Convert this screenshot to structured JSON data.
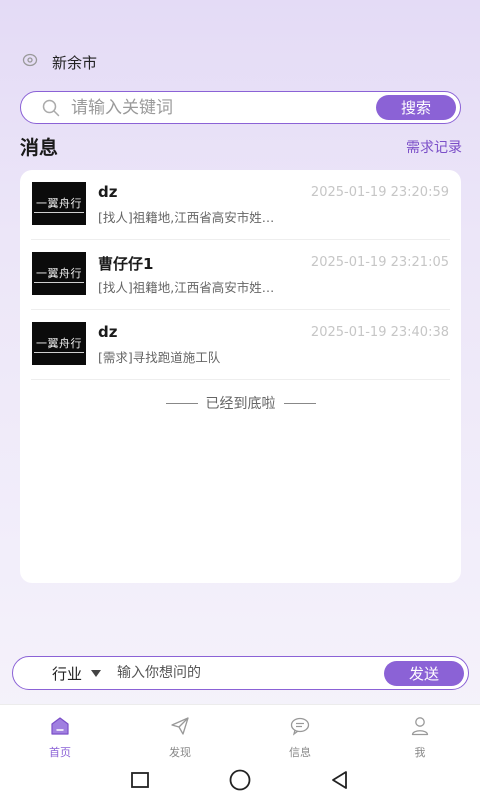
{
  "location": {
    "city": "新余市",
    "icon": "location-pin-icon"
  },
  "search": {
    "placeholder": "请输入关键词",
    "button_label": "搜索"
  },
  "section": {
    "title": "消息",
    "link_label": "需求记录"
  },
  "messages": [
    {
      "name": "dz",
      "time": "2025-01-19 23:20:59",
      "preview": "[找人]祖籍地,江西省高安市姓…",
      "avatar_text": "一翼舟行"
    },
    {
      "name": "曹仔仔1",
      "time": "2025-01-19 23:21:05",
      "preview": "[找人]祖籍地,江西省高安市姓…",
      "avatar_text": "一翼舟行"
    },
    {
      "name": "dz",
      "time": "2025-01-19 23:40:38",
      "preview": "[需求]寻找跑道施工队",
      "avatar_text": "一翼舟行"
    }
  ],
  "end_note": "已经到底啦",
  "ask": {
    "industry_label": "行业",
    "placeholder": "输入你想问的",
    "send_label": "发送"
  },
  "tabs": [
    {
      "label": "首页",
      "icon": "home-icon",
      "active": true
    },
    {
      "label": "发现",
      "icon": "paper-plane-icon",
      "active": false
    },
    {
      "label": "信息",
      "icon": "chat-bubble-icon",
      "active": false
    },
    {
      "label": "我",
      "icon": "user-icon",
      "active": false
    }
  ],
  "colors": {
    "accent": "#8b62d6",
    "link": "#7b4fc8",
    "time": "#c6c6c6"
  }
}
